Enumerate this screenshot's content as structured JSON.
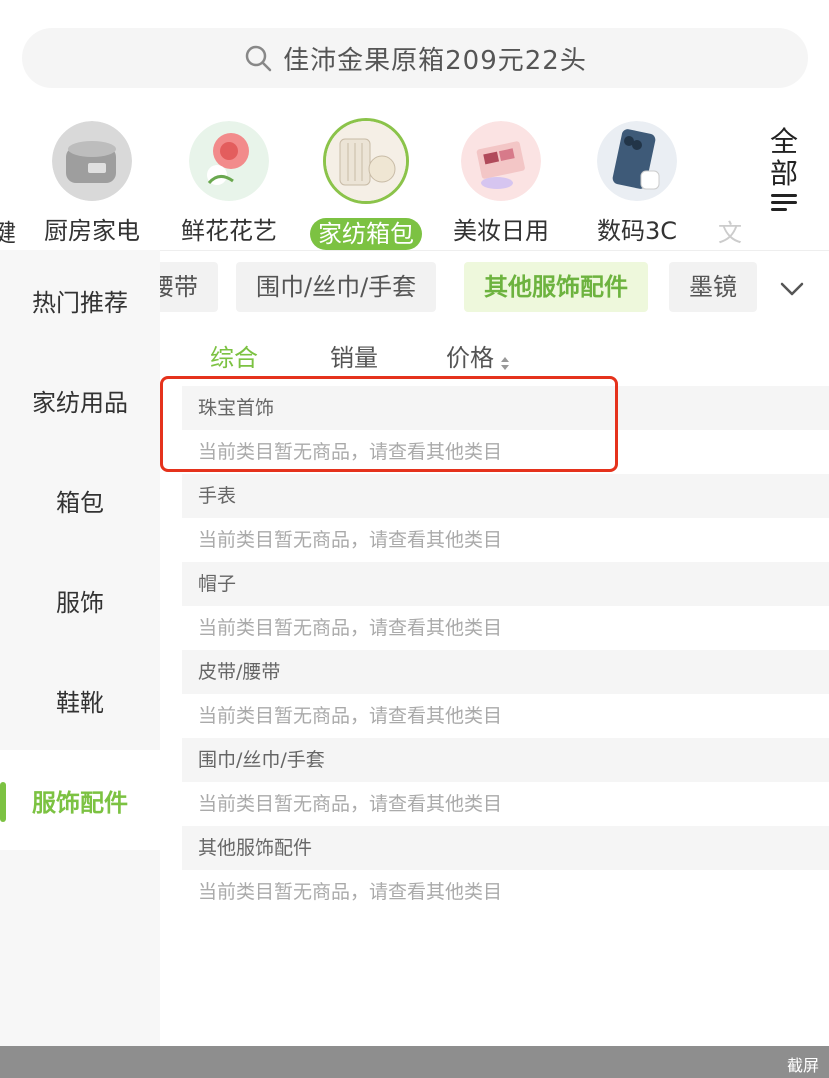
{
  "search": {
    "text": "佳沛金果原箱209元22头",
    "icon": "search-icon"
  },
  "categories": {
    "partial_left": "健",
    "items": [
      {
        "label": "厨房家电",
        "icon": "rice-cooker-image"
      },
      {
        "label": "鲜花花艺",
        "icon": "flower-image"
      },
      {
        "label": "家纺箱包",
        "icon": "luggage-image",
        "active": true
      },
      {
        "label": "美妆日用",
        "icon": "makeup-palette-image"
      },
      {
        "label": "数码3C",
        "icon": "smartphone-image"
      }
    ],
    "partial_right": "文",
    "all_button": {
      "label": "全部",
      "icon": "menu-list-icon"
    }
  },
  "sidebar": {
    "items": [
      {
        "label": "热门推荐"
      },
      {
        "label": "家纺用品"
      },
      {
        "label": "箱包"
      },
      {
        "label": "服饰"
      },
      {
        "label": "鞋靴"
      },
      {
        "label": "服饰配件",
        "active": true
      }
    ]
  },
  "tags": {
    "items": [
      "腰带",
      "围巾/丝巾/手套",
      "其他服饰配件",
      "墨镜"
    ],
    "active": "其他服饰配件"
  },
  "sort": {
    "items": [
      "综合",
      "销量",
      "价格"
    ],
    "active": "综合"
  },
  "sections": [
    {
      "title": "珠宝首饰",
      "empty_text": "当前类目暂无商品，请查看其他类目"
    },
    {
      "title": "手表",
      "empty_text": "当前类目暂无商品，请查看其他类目"
    },
    {
      "title": "帽子",
      "empty_text": "当前类目暂无商品，请查看其他类目"
    },
    {
      "title": "皮带/腰带",
      "empty_text": "当前类目暂无商品，请查看其他类目"
    },
    {
      "title": "围巾/丝巾/手套",
      "empty_text": "当前类目暂无商品，请查看其他类目"
    },
    {
      "title": "其他服饰配件",
      "empty_text": "当前类目暂无商品，请查看其他类目"
    }
  ],
  "bottom_bar": {
    "label": "截屏"
  },
  "colors": {
    "accent": "#7cc242",
    "highlight": "#e5321c"
  }
}
